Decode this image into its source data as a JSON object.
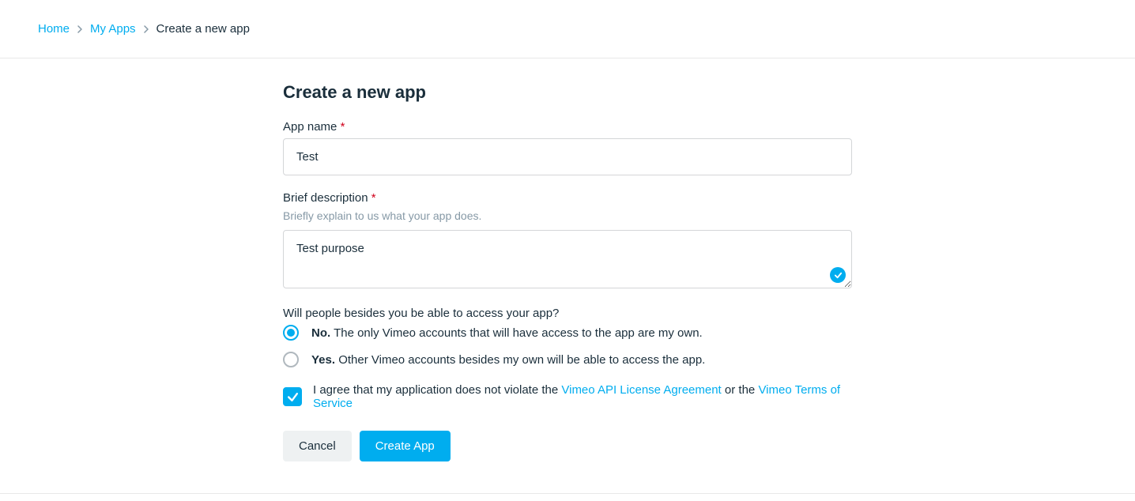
{
  "breadcrumb": {
    "home": "Home",
    "my_apps": "My Apps",
    "current": "Create a new app"
  },
  "page_title": "Create a new app",
  "form": {
    "app_name": {
      "label": "App name",
      "value": "Test"
    },
    "description": {
      "label": "Brief description",
      "help": "Briefly explain to us what your app does.",
      "value": "Test purpose"
    },
    "access_question": "Will people besides you be able to access your app?",
    "radio_no": {
      "strong": "No.",
      "rest": " The only Vimeo accounts that will have access to the app are my own."
    },
    "radio_yes": {
      "strong": "Yes.",
      "rest": " Other Vimeo accounts besides my own will be able to access the app."
    },
    "agreement": {
      "prefix": "I agree that my application does not violate the ",
      "link1": "Vimeo API License Agreement",
      "mid": " or the ",
      "link2": "Vimeo Terms of Service"
    },
    "cancel": "Cancel",
    "create": "Create App"
  }
}
